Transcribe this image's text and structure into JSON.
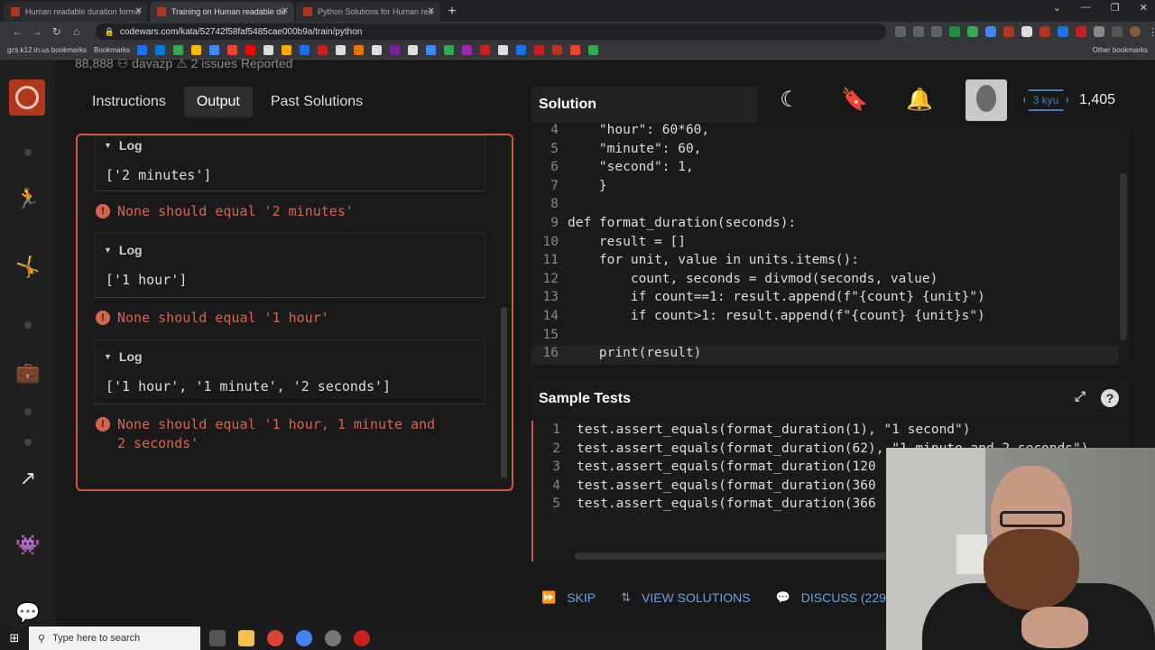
{
  "browser": {
    "tabs": [
      {
        "label": "Human readable duration forma",
        "active": false
      },
      {
        "label": "Training on Human readable du",
        "active": true
      },
      {
        "label": "Python Solutions for Human rea",
        "active": false
      }
    ],
    "url": "codewars.com/kata/52742f58faf5485cae000b9a/train/python",
    "bookmarks_label": "gcs.k12.in.us bookmarks",
    "bookmarks_folder": "Bookmarks",
    "other_bookmarks": "Other bookmarks"
  },
  "kata_stats": "88,888   ⚇ davazp   ⚠ 2 issues Reported",
  "left_tabs": {
    "instructions": "Instructions",
    "output": "Output",
    "past_solutions": "Past Solutions"
  },
  "output": {
    "log_header": "Log",
    "logs": [
      {
        "value": "['2 minutes']",
        "error": "None should equal '2 minutes'"
      },
      {
        "value": "['1 hour']",
        "error": "None should equal '1 hour'"
      },
      {
        "value": "['1 hour', '1 minute', '2 seconds']",
        "error_line1": "None should equal '1 hour, 1 minute and",
        "error_line2": "2 seconds'"
      }
    ]
  },
  "solution": {
    "title": "Solution",
    "lines": [
      {
        "n": "4",
        "code": "    \"hour\": 60*60,"
      },
      {
        "n": "5",
        "code": "    \"minute\": 60,"
      },
      {
        "n": "6",
        "code": "    \"second\": 1,"
      },
      {
        "n": "7",
        "code": "    }"
      },
      {
        "n": "8",
        "code": ""
      },
      {
        "n": "9",
        "code": "def format_duration(seconds):"
      },
      {
        "n": "10",
        "code": "    result = []"
      },
      {
        "n": "11",
        "code": "    for unit, value in units.items():"
      },
      {
        "n": "12",
        "code": "        count, seconds = divmod(seconds, value)"
      },
      {
        "n": "13",
        "code": "        if count==1: result.append(f\"{count} {unit}\")"
      },
      {
        "n": "14",
        "code": "        if count>1: result.append(f\"{count} {unit}s\")"
      },
      {
        "n": "15",
        "code": ""
      },
      {
        "n": "16",
        "code": "    print(result)"
      }
    ]
  },
  "user": {
    "rank": "3 kyu",
    "honor": "1,405"
  },
  "sample_tests": {
    "title": "Sample Tests",
    "lines": [
      {
        "n": "1",
        "code": "test.assert_equals(format_duration(1), \"1 second\")"
      },
      {
        "n": "2",
        "code": "test.assert_equals(format_duration(62), \"1 minute and 2 seconds\")"
      },
      {
        "n": "3",
        "code": "test.assert_equals(format_duration(120"
      },
      {
        "n": "4",
        "code": "test.assert_equals(format_duration(360"
      },
      {
        "n": "5",
        "code": "test.assert_equals(format_duration(366"
      }
    ]
  },
  "actions": {
    "skip": "SKIP",
    "view_solutions": "VIEW SOLUTIONS",
    "discuss": "DISCUSS (229)"
  },
  "taskbar": {
    "search_placeholder": "Type here to search"
  },
  "colors": {
    "accent_red": "#b1361e",
    "error_red": "#d6654f",
    "rank_blue": "#3c7ebb"
  }
}
